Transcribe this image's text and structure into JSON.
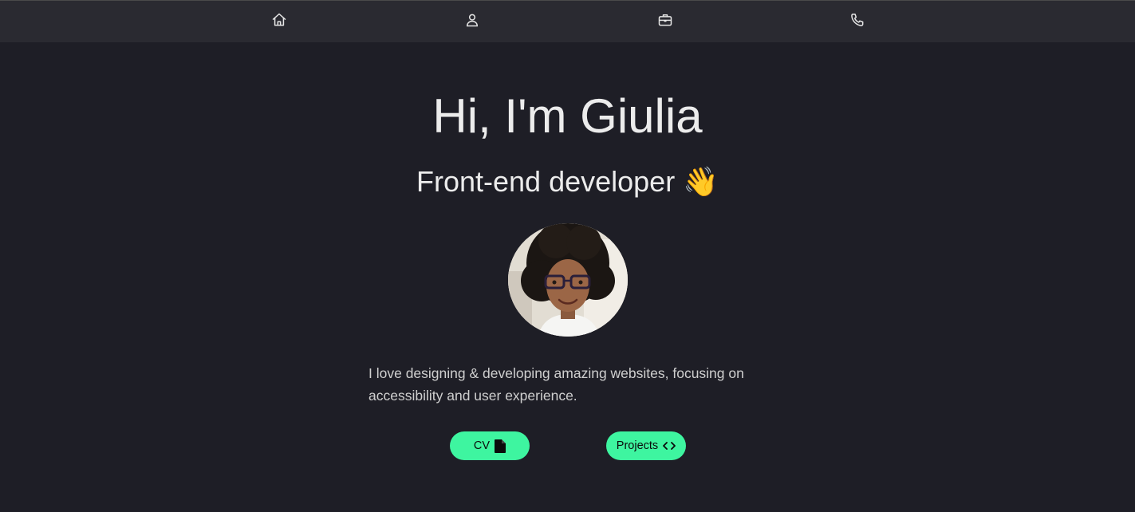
{
  "nav": {
    "items": [
      {
        "icon": "home-icon"
      },
      {
        "icon": "user-icon"
      },
      {
        "icon": "briefcase-icon"
      },
      {
        "icon": "phone-icon"
      }
    ]
  },
  "hero": {
    "title": "Hi, I'm Giulia",
    "subtitle": "Front-end developer",
    "subtitle_emoji": "👋",
    "bio": "I love designing & developing amazing websites, focusing on accessibility and user experience."
  },
  "buttons": {
    "cv_label": "CV",
    "cv_icon": "file-icon",
    "projects_label": "Projects",
    "projects_icon": "code-icon"
  },
  "colors": {
    "background": "#1e1e26",
    "navbar": "#2a2a31",
    "accent": "#3ef5a0",
    "text": "#ececec"
  }
}
